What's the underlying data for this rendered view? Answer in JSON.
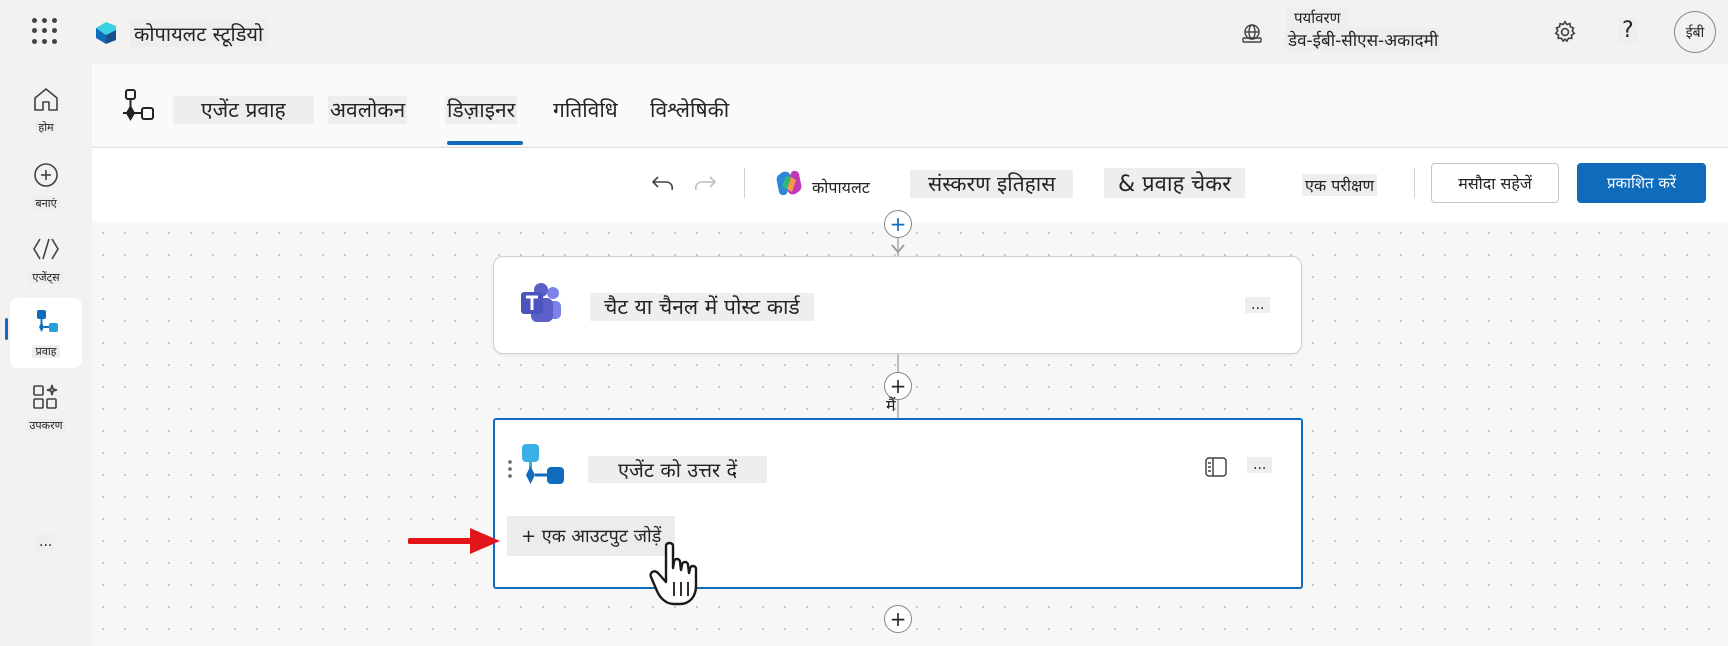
{
  "topbar": {
    "app_title": "कोपायलट स्टूडियो",
    "environment_label": "पर्यावरण",
    "environment_value": "डेव-ईबी-सीएस-अकादमी",
    "help_label": "?",
    "avatar_initials": "ईबी"
  },
  "rail": {
    "items": [
      {
        "label": "होम",
        "icon": "home-icon"
      },
      {
        "label": "बनाएं",
        "icon": "create-icon"
      },
      {
        "label": "एजेंट्स",
        "icon": "agents-icon"
      },
      {
        "label": "प्रवाह",
        "icon": "flows-icon",
        "active": true
      },
      {
        "label": "उपकरण",
        "icon": "tools-icon"
      }
    ],
    "more": "..."
  },
  "header": {
    "flow_name": "एजेंट प्रवाह",
    "tabs": [
      {
        "label": "अवलोकन"
      },
      {
        "label": "डिज़ाइनर",
        "active": true
      },
      {
        "label": "गतिविधि"
      },
      {
        "label": "विश्लेषिकी"
      }
    ]
  },
  "toolbar": {
    "copilot": "कोपायलट",
    "version_history": "संस्करण इतिहास",
    "flow_checker": "& प्रवाह चेकर",
    "test": "एक परीक्षण",
    "save_draft": "मसौदा सहेजें",
    "publish": "प्रकाशित करें"
  },
  "canvas": {
    "card_teams": {
      "title": "चैट या चैनल में पोस्ट कार्ड",
      "more": "..."
    },
    "connector_label": "मैं",
    "card_respond": {
      "title": "एजेंट को उत्तर दें",
      "more": "...",
      "add_output": "+ एक आउटपुट जोड़ें"
    }
  },
  "colors": {
    "accent": "#0f6cbd",
    "arrow": "#e3151a",
    "teams": "#5b5fc7"
  }
}
